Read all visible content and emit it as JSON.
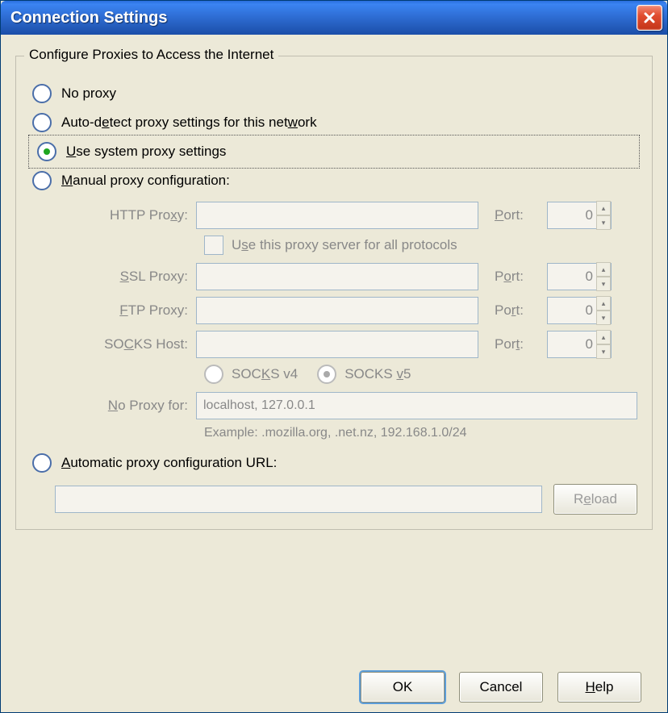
{
  "titlebar": {
    "title": "Connection Settings"
  },
  "group": {
    "legend": "Configure Proxies to Access the Internet"
  },
  "radios": {
    "no_proxy": "No proxy",
    "auto_detect_pre": "Auto-d",
    "auto_detect_ul": "e",
    "auto_detect_mid": "tect proxy settings for this net",
    "auto_detect_ul2": "w",
    "auto_detect_post": "ork",
    "use_system_pre": "",
    "use_system_ul": "U",
    "use_system_post": "se system proxy settings",
    "manual_ul": "M",
    "manual_post": "anual proxy configuration:",
    "auto_url_ul": "A",
    "auto_url_post": "utomatic proxy configuration URL:"
  },
  "labels": {
    "http_pre": "HTTP Pro",
    "http_ul": "x",
    "http_post": "y:",
    "ssl_ul": "S",
    "ssl_post": "SL Proxy:",
    "ftp_ul": "F",
    "ftp_post": "TP Proxy:",
    "socks_pre": "SO",
    "socks_ul": "C",
    "socks_post": "KS Host:",
    "noproxy_ul": "N",
    "noproxy_post": "o Proxy for:",
    "port_ul": "P",
    "port_post": "ort:",
    "port2_pre": "P",
    "port2_ul": "o",
    "port2_post": "rt:",
    "port3_pre": "Po",
    "port3_ul": "r",
    "port3_post": "t:",
    "port4_pre": "Por",
    "port4_ul": "t",
    "port4_post": ":"
  },
  "values": {
    "http_host": "",
    "http_port": "0",
    "ssl_host": "",
    "ssl_port": "0",
    "ftp_host": "",
    "ftp_port": "0",
    "socks_host": "",
    "socks_port": "0",
    "noproxy": "localhost, 127.0.0.1",
    "pac_url": ""
  },
  "checkbox": {
    "use_same_pre": "U",
    "use_same_ul": "s",
    "use_same_post": "e this proxy server for all protocols"
  },
  "socks_versions": {
    "v4_pre": "SOC",
    "v4_ul": "K",
    "v4_post": "S v4",
    "v5_pre": "SOCKS ",
    "v5_ul": "v",
    "v5_post": "5"
  },
  "hint": {
    "example": "Example: .mozilla.org, .net.nz, 192.168.1.0/24"
  },
  "buttons": {
    "reload_pre": "R",
    "reload_ul": "e",
    "reload_post": "load",
    "ok": "OK",
    "cancel": "Cancel",
    "help_ul": "H",
    "help_post": "elp"
  }
}
